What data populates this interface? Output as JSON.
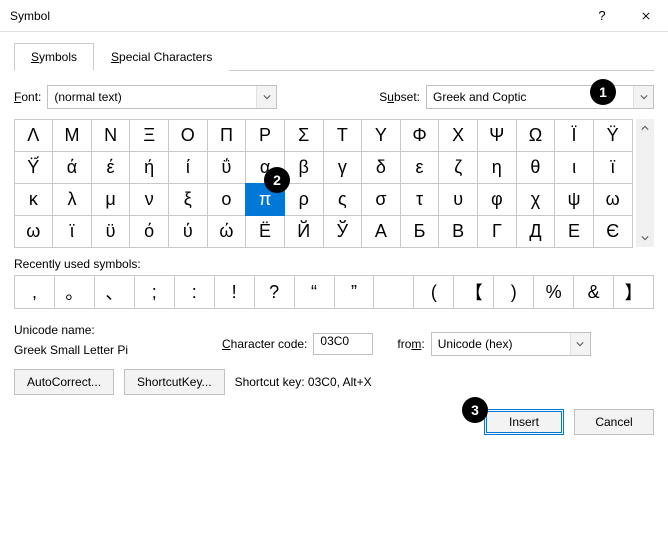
{
  "window": {
    "title": "Symbol"
  },
  "tabs": {
    "symbols_prefix": "S",
    "symbols_rest": "ymbols",
    "special_prefix": "S",
    "special_rest": "pecial Characters"
  },
  "font": {
    "label_prefix": "F",
    "label_rest": "ont:",
    "value": "(normal text)"
  },
  "subset": {
    "label_prefix": "S",
    "label_ul": "u",
    "label_rest": "bset:",
    "value": "Greek and Coptic"
  },
  "grid": [
    [
      "Λ",
      "Μ",
      "Ν",
      "Ξ",
      "Ο",
      "Π",
      "Ρ",
      "Σ",
      "Τ",
      "Υ",
      "Φ",
      "Χ",
      "Ψ",
      "Ω",
      "Ϊ",
      "Ϋ"
    ],
    [
      "Ϋ́",
      "ά",
      "έ",
      "ή",
      "ί",
      "ΰ",
      "α",
      "β",
      "γ",
      "δ",
      "ε",
      "ζ",
      "η",
      "θ",
      "ι",
      "ϊ"
    ],
    [
      "κ",
      "λ",
      "μ",
      "ν",
      "ξ",
      "ο",
      "π",
      "ρ",
      "ς",
      "σ",
      "τ",
      "υ",
      "φ",
      "χ",
      "ψ",
      "ω"
    ],
    [
      "ω",
      "ϊ",
      "ϋ",
      "ό",
      "ύ",
      "ώ",
      "Ё",
      "Й",
      "Ў",
      "А",
      "Б",
      "В",
      "Г",
      "Д",
      "Е",
      "Є"
    ]
  ],
  "selected": {
    "row": 2,
    "col": 6
  },
  "recent_label_prefix": "R",
  "recent_label_rest": "ecently used symbols:",
  "recent": [
    ",",
    "。",
    "、",
    ";",
    ":",
    "!",
    "?",
    "“",
    "”",
    " ",
    "(",
    "【",
    ")",
    "%",
    "&",
    "】"
  ],
  "unicode_label": "Unicode name:",
  "unicode_name": "Greek Small Letter Pi",
  "charcode": {
    "label_ul": "C",
    "label_rest": "haracter code:",
    "value": "03C0"
  },
  "from": {
    "label_prefix": "fro",
    "label_ul": "m",
    "label_rest": ":",
    "value": "Unicode (hex)"
  },
  "autocorrect": {
    "ul": "A",
    "rest": "utoCorrect..."
  },
  "shortcutkey_btn": {
    "text": "Shortcut ",
    "ul": "K",
    "rest": "ey..."
  },
  "shortcut_text": "Shortcut key: 03C0, Alt+X",
  "insert": "Insert",
  "cancel": "Cancel",
  "badges": {
    "b1": "1",
    "b2": "2",
    "b3": "3"
  }
}
